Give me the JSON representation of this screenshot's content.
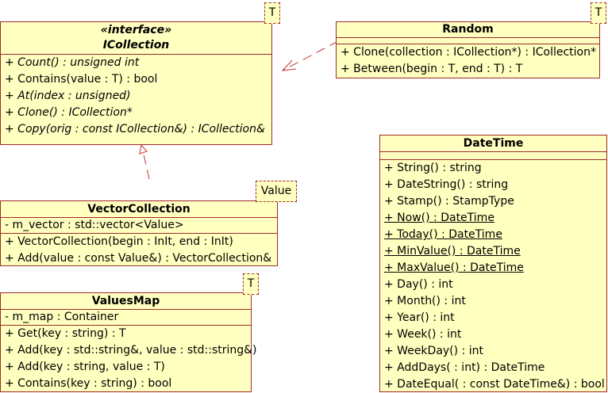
{
  "icollection": {
    "stereotype": "«interface»",
    "name": "ICollection",
    "template_param": "T",
    "operations": [
      {
        "text": "+ Count() : unsigned int",
        "style": "it"
      },
      {
        "text": "+ Contains(value : T) : bool",
        "style": ""
      },
      {
        "text": "+ At(index : unsigned)",
        "style": "it"
      },
      {
        "text": "+ Clone() : ICollection*",
        "style": "it"
      },
      {
        "text": "+ Copy(orig : const ICollection&) : ICollection&",
        "style": "it"
      }
    ]
  },
  "random": {
    "name": "Random",
    "template_param": "T",
    "operations": [
      {
        "text": "+ Clone(collection : ICollection*) : ICollection*",
        "style": ""
      },
      {
        "text": "+ Between(begin : T, end : T) : T",
        "style": ""
      }
    ]
  },
  "vectorcollection": {
    "name": "VectorCollection",
    "template_param": "Value",
    "attributes": [
      {
        "text": "- m_vector : std::vector<Value>",
        "style": ""
      }
    ],
    "operations": [
      {
        "text": "+ VectorCollection(begin : InIt, end : InIt)",
        "style": ""
      },
      {
        "text": "+ Add(value : const Value&) : VectorCollection&",
        "style": ""
      }
    ]
  },
  "valuesmap": {
    "name": "ValuesMap",
    "template_param": "T",
    "attributes": [
      {
        "text": "- m_map : Container",
        "style": ""
      }
    ],
    "operations": [
      {
        "text": "+ Get(key : string) : T",
        "style": ""
      },
      {
        "text": "+ Add(key : std::string&, value : std::string&)",
        "style": ""
      },
      {
        "text": "+ Add(key : string, value : T)",
        "style": ""
      },
      {
        "text": "+ Contains(key : string) : bool",
        "style": ""
      }
    ]
  },
  "datetime": {
    "name": "DateTime",
    "operations": [
      {
        "text": "+ String() : string",
        "style": ""
      },
      {
        "text": "+ DateString() : string",
        "style": ""
      },
      {
        "text": "+ Stamp() : StampType",
        "style": ""
      },
      {
        "text": "+ Now() : DateTime",
        "style": "u"
      },
      {
        "text": "+ Today() : DateTime",
        "style": "u"
      },
      {
        "text": "+ MinValue() : DateTime",
        "style": "u"
      },
      {
        "text": "+ MaxValue() : DateTime",
        "style": "u"
      },
      {
        "text": "+ Day() : int",
        "style": ""
      },
      {
        "text": "+ Month() : int",
        "style": ""
      },
      {
        "text": "+ Year() : int",
        "style": ""
      },
      {
        "text": "+ Week() : int",
        "style": ""
      },
      {
        "text": "+ WeekDay() : int",
        "style": ""
      },
      {
        "text": "+ AddDays( : int) : DateTime",
        "style": ""
      },
      {
        "text": "+ DateEqual( : const DateTime&) : bool",
        "style": ""
      }
    ]
  },
  "colors": {
    "fill": "#ffffc0",
    "border": "#9e2a2a",
    "relation": "#cc3333"
  }
}
